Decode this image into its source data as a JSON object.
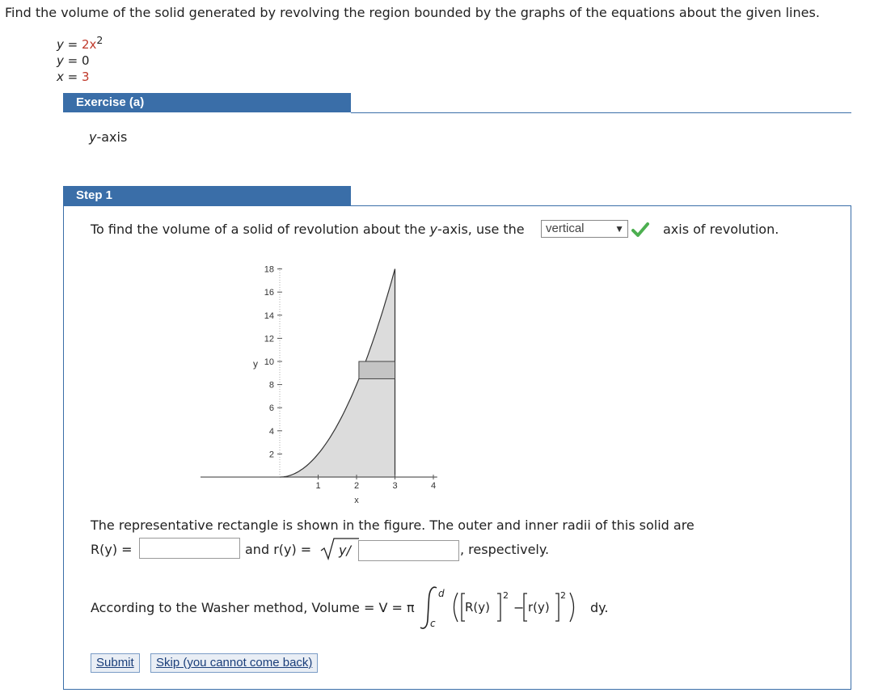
{
  "problem": {
    "text": "Find the volume of the solid generated by revolving the region bounded by the graphs of the equations about the given lines.",
    "equations": [
      {
        "var": "y",
        "eq": " = ",
        "val": "2x",
        "sup": "2"
      },
      {
        "var": "y",
        "eq": " = ",
        "val": "0",
        "sup": ""
      },
      {
        "var": "x",
        "eq": " = ",
        "val": "3",
        "sup": ""
      }
    ]
  },
  "exercise": {
    "header": "Exercise (a)",
    "axis_var": "y",
    "axis_suffix": "-axis"
  },
  "step": {
    "header": "Step 1",
    "sentence_a": "To find the volume of a solid of revolution about the ",
    "sentence_var": "y",
    "sentence_b": "-axis, use the",
    "dropdown_value": "vertical",
    "sentence_c": "axis of revolution.",
    "rect_text": "The representative rectangle is shown in the figure. The outer and inner radii of this solid are",
    "R_label": "R(y) =",
    "and_r_label": "and r(y) =",
    "sqrt_text": "y/",
    "respectively": ", respectively.",
    "washer_text": "According to the Washer method, Volume = V = π",
    "integral_upper": "d",
    "integral_lower": "c",
    "R_term": "R(y)",
    "r_term": "r(y)",
    "power": "2",
    "minus": "−",
    "dy": "dy."
  },
  "chart_data": {
    "type": "area",
    "x_label": "x",
    "y_label": "y",
    "x_ticks": [
      "1",
      "2",
      "3",
      "4"
    ],
    "y_ticks": [
      "2",
      "4",
      "6",
      "8",
      "10",
      "12",
      "14",
      "16",
      "18"
    ],
    "xlim": [
      0,
      4
    ],
    "ylim": [
      0,
      18
    ],
    "curve": "y = 2x^2",
    "region": {
      "x_from": 0,
      "x_to": 3
    },
    "rectangle": {
      "y_from": 8.5,
      "y_to": 10
    }
  },
  "buttons": {
    "submit": "Submit",
    "skip": "Skip (you cannot come back)"
  },
  "colors": {
    "header_bg": "#3a6ea8",
    "check_green": "#4caf50",
    "region_fill": "#dcdcdc"
  }
}
